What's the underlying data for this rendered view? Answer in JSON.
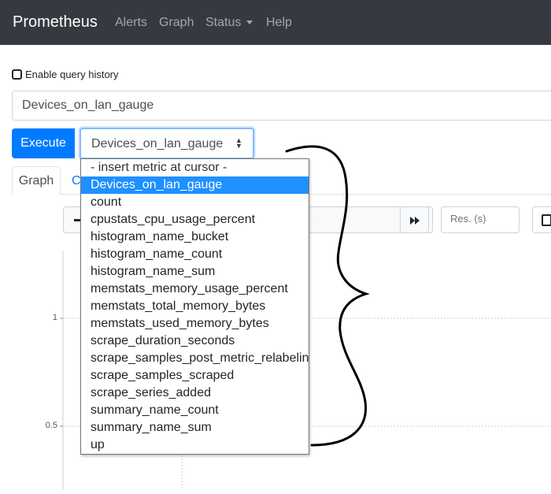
{
  "navbar": {
    "brand": "Prometheus",
    "links": [
      "Alerts",
      "Graph",
      "Status",
      "Help"
    ]
  },
  "query_history": {
    "label": "Enable query history",
    "checked": false
  },
  "expression": {
    "value": "Devices_on_lan_gauge"
  },
  "execute": {
    "label": "Execute"
  },
  "metric_select": {
    "value": "Devices_on_lan_gauge",
    "options": [
      "- insert metric at cursor -",
      "Devices_on_lan_gauge",
      "count",
      "cpustats_cpu_usage_percent",
      "histogram_name_bucket",
      "histogram_name_count",
      "histogram_name_sum",
      "memstats_memory_usage_percent",
      "memstats_total_memory_bytes",
      "memstats_used_memory_bytes",
      "scrape_duration_seconds",
      "scrape_samples_post_metric_relabeling",
      "scrape_samples_scraped",
      "scrape_series_added",
      "summary_name_count",
      "summary_name_sum",
      "up"
    ],
    "selected_index": 1
  },
  "tabs": {
    "graph": "Graph",
    "console": "C"
  },
  "controls": {
    "resolution_placeholder": "Res. (s)"
  },
  "graph": {
    "y_ticks": [
      "1",
      "0.5"
    ]
  },
  "colors": {
    "navbar": "#343a40",
    "primary": "#007bff",
    "selected_option": "#1e90ff"
  },
  "icons": {
    "range_decrease": "minus-icon",
    "end_time_forward": "fast-forward-icon",
    "select_arrows": "sort-arrows-icon",
    "status_dropdown": "caret-down-icon"
  }
}
